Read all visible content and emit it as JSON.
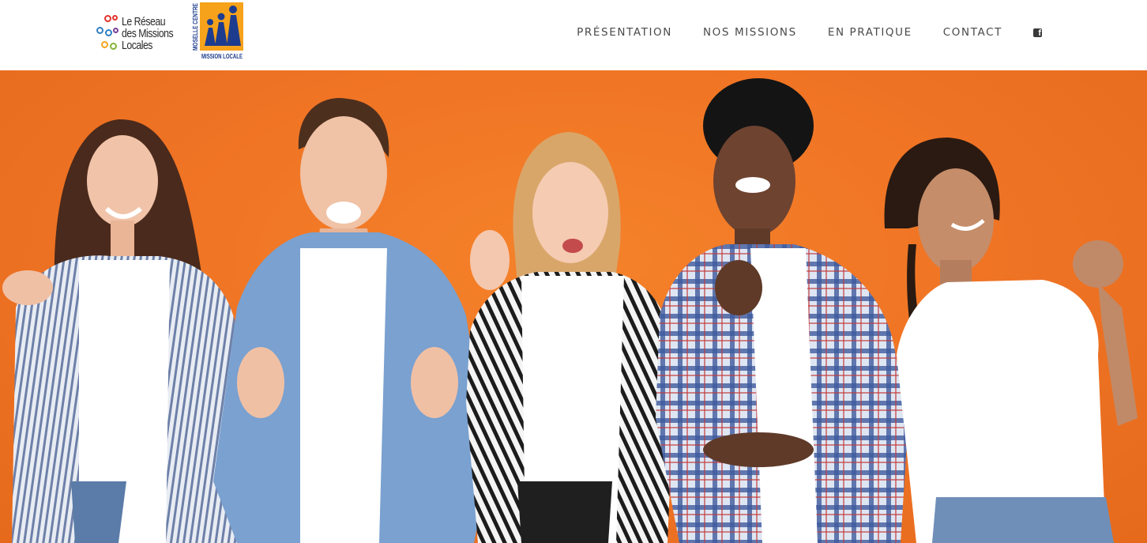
{
  "header": {
    "logo_reseau": {
      "line1": "Le Réseau",
      "line2": "des Missions",
      "line3": "Locales"
    },
    "logo_mission_locale": {
      "vertical_text": "MOSELLE CENTRE",
      "bottom_text": "MISSION LOCALE"
    },
    "nav": {
      "items": [
        {
          "label": "PRÉSENTATION"
        },
        {
          "label": "NOS MISSIONS"
        },
        {
          "label": "EN PRATIQUE"
        },
        {
          "label": "CONTACT"
        }
      ],
      "social_icon": "facebook-icon"
    }
  },
  "hero": {
    "description_icon": "photo-group-of-five-young-people",
    "background_color": "#f07828"
  },
  "colors": {
    "header_bg": "#ffffff",
    "nav_text": "#4a4a4a",
    "ml_orange": "#f6a21a",
    "ml_blue": "#1d3c8e",
    "hero_orange": "#f07828"
  }
}
